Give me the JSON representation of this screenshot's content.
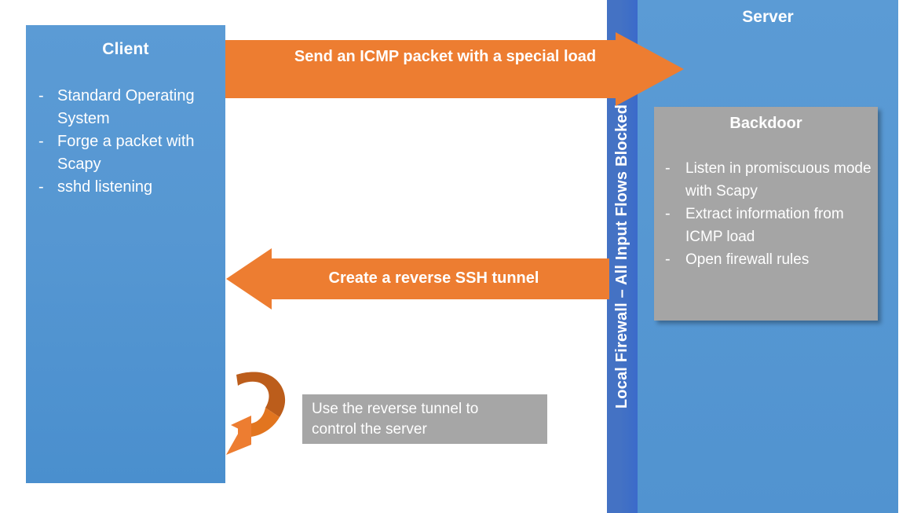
{
  "diagram": {
    "title": "ICMP backdoor reverse SSH tunnel diagram",
    "colors": {
      "panel_blue": "#5B9BD5",
      "firewall_blue": "#4472C4",
      "arrow_orange": "#ED7D31",
      "loop_arrow_dark_orange": "#BC5D1B",
      "gray_box": "#A5A5A5",
      "text_white": "#FFFFFF"
    }
  },
  "client": {
    "title": "Client",
    "bullet_marker": "-",
    "items": [
      "Standard Operating System",
      "Forge a packet with Scapy",
      "sshd listening"
    ]
  },
  "firewall": {
    "label": "Local Firewall – All Input Flows Blocked"
  },
  "server": {
    "title": "Server"
  },
  "backdoor": {
    "title": "Backdoor",
    "bullet_marker": "-",
    "items": [
      "Listen in promiscuous mode with Scapy",
      "Extract information from ICMP load",
      "Open firewall rules"
    ]
  },
  "arrows": {
    "send": {
      "label": "Send an ICMP packet with a special load",
      "direction": "right",
      "icon": "right-block-arrow-icon"
    },
    "reverse": {
      "label": "Create a reverse SSH tunnel",
      "direction": "left",
      "icon": "left-block-arrow-icon"
    },
    "loop": {
      "label": "",
      "direction": "circular",
      "icon": "circular-arrow-icon"
    }
  },
  "caption": {
    "line1": "Use the reverse tunnel to",
    "line2": "control the server"
  }
}
